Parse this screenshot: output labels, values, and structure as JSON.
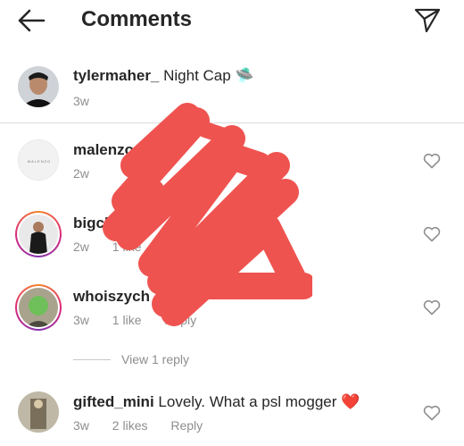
{
  "header": {
    "title": "Comments",
    "back_icon": "arrow-left-icon",
    "send_icon": "paper-plane-icon"
  },
  "caption": {
    "username": "tylermaher_",
    "text": "Night Cap",
    "emoji": "🛸",
    "time": "3w"
  },
  "comments": [
    {
      "username": "malenzo",
      "text": "",
      "time": "2w",
      "likes": "",
      "reply": "",
      "story_ring": false,
      "avatar_text": "MALENZO"
    },
    {
      "username": "bigchris",
      "text": "",
      "time": "2w",
      "likes": "1 like",
      "reply": "",
      "story_ring": true
    },
    {
      "username": "whoiszych",
      "text": "",
      "time": "3w",
      "likes": "1 like",
      "reply": "Reply",
      "story_ring": true
    },
    {
      "username": "gifted_mini",
      "text": "Lovely. What a psl mogger",
      "emoji": "❤️",
      "time": "3w",
      "likes": "2 likes",
      "reply": "Reply",
      "story_ring": false
    }
  ],
  "view_replies": "View 1 reply",
  "colors": {
    "accent_heart": "#ed4956",
    "muted": "#8e8e8e",
    "scribble": "#ef5350"
  }
}
